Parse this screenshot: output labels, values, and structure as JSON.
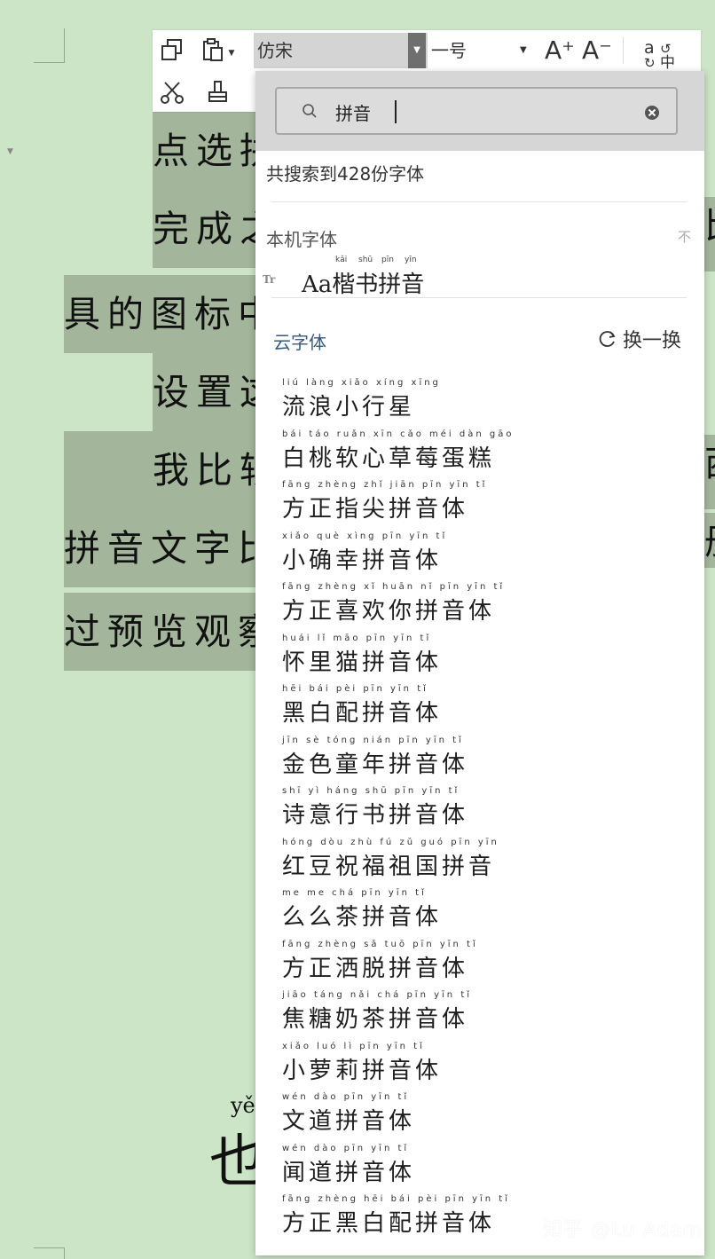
{
  "document": {
    "lines": [
      "点选拼",
      "完成之",
      "具的图标中",
      "设置这",
      "我比较",
      "拼音文字比",
      "过预览观察"
    ],
    "right_fragments": [
      "比",
      "西",
      "册"
    ],
    "bottom_pinyin": "yě",
    "bottom_char": "也"
  },
  "toolbar": {
    "font_name": "仿宋",
    "font_size": "一号",
    "grow_label": "A⁺",
    "shrink_label": "A⁻"
  },
  "font_search": {
    "query": "拼音",
    "result_count": "共搜索到428份字体",
    "local_section_title": "本机字体",
    "pin_label": "不",
    "local_font": {
      "name": "Aa楷书拼音",
      "pinyin": [
        "kǎi",
        "shū",
        "pīn",
        "yīn"
      ]
    },
    "cloud_section_title": "云字体",
    "refresh_label": "换一换",
    "cloud_fonts": [
      {
        "name": "流浪小行星",
        "pinyin": "liú làng xiǎo xíng xīng"
      },
      {
        "name": "白桃软心草莓蛋糕",
        "pinyin": "bái táo ruǎn xīn cǎo méi dàn gāo"
      },
      {
        "name": "方正指尖拼音体",
        "pinyin": "fāng zhèng zhǐ jiān pīn yīn tǐ"
      },
      {
        "name": "小确幸拼音体",
        "pinyin": "xiǎo què xìng pīn yīn tǐ"
      },
      {
        "name": "方正喜欢你拼音体",
        "pinyin": "fāng zhèng xǐ huān nǐ pīn yīn tǐ"
      },
      {
        "name": "怀里猫拼音体",
        "pinyin": "huái lǐ māo pīn yīn tǐ"
      },
      {
        "name": "黑白配拼音体",
        "pinyin": "hēi bái pèi pīn yīn tǐ"
      },
      {
        "name": "金色童年拼音体",
        "pinyin": "jīn sè tóng nián pīn yīn tǐ"
      },
      {
        "name": "诗意行书拼音体",
        "pinyin": "shī yì háng shū pīn yīn tǐ"
      },
      {
        "name": "红豆祝福祖国拼音",
        "pinyin": "hóng dòu zhù fú zǔ guó pīn yīn"
      },
      {
        "name": "么么茶拼音体",
        "pinyin": "me me chá pīn yīn tǐ"
      },
      {
        "name": "方正洒脱拼音体",
        "pinyin": "fāng zhèng sǎ tuō pīn yīn tǐ"
      },
      {
        "name": "焦糖奶茶拼音体",
        "pinyin": "jiāo táng nǎi chá pīn yīn tǐ"
      },
      {
        "name": "小萝莉拼音体",
        "pinyin": "xiǎo luó lì pīn yīn tǐ"
      },
      {
        "name": "文道拼音体",
        "pinyin": "wén dào pīn yīn tǐ"
      },
      {
        "name": "闻道拼音体",
        "pinyin": "wén dào pīn yīn tǐ"
      },
      {
        "name": "方正黑白配拼音体",
        "pinyin": "fāng zhèng hēi bái pèi pīn yīn tǐ"
      }
    ]
  },
  "watermark": "知乎 @Lu Adam",
  "colors": {
    "background": "#cce5c7",
    "highlight": "#a3b59b",
    "search_bar": "#d6d6d6",
    "cloud_title": "#3a5a7a"
  }
}
